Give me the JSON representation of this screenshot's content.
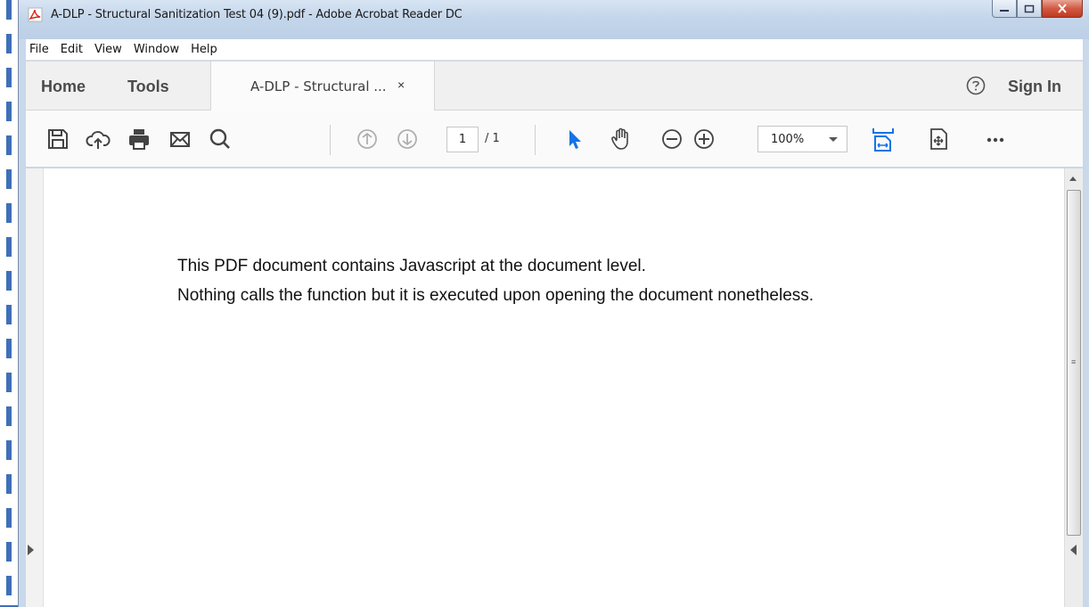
{
  "window": {
    "title": "A-DLP - Structural Sanitization Test 04 (9).pdf - Adobe Acrobat Reader DC",
    "app_icon": "acrobat-pdf-icon",
    "controls": [
      "minimize-icon",
      "maximize-icon",
      "close-icon"
    ]
  },
  "menu": {
    "items": [
      "File",
      "Edit",
      "View",
      "Window",
      "Help"
    ]
  },
  "tabs": {
    "home": "Home",
    "tools": "Tools",
    "document": "A-DLP - Structural ...",
    "close_glyph": "×",
    "sign_in": "Sign In"
  },
  "toolbar": {
    "icons": [
      "save-icon",
      "upload-cloud-icon",
      "print-icon",
      "email-icon",
      "search-icon",
      "page-up-icon",
      "page-down-icon",
      "select-arrow-icon",
      "hand-icon",
      "zoom-out-icon",
      "zoom-in-icon",
      "fit-page-icon",
      "scrolling-mode-icon",
      "more-icon"
    ],
    "page_current": "1",
    "page_total": "/ 1",
    "zoom": "100%",
    "accent_color": "#1473e6"
  },
  "document": {
    "lines": [
      "This PDF document contains Javascript at the document level.",
      "Nothing calls the function but it is executed upon opening the document nonetheless."
    ]
  }
}
